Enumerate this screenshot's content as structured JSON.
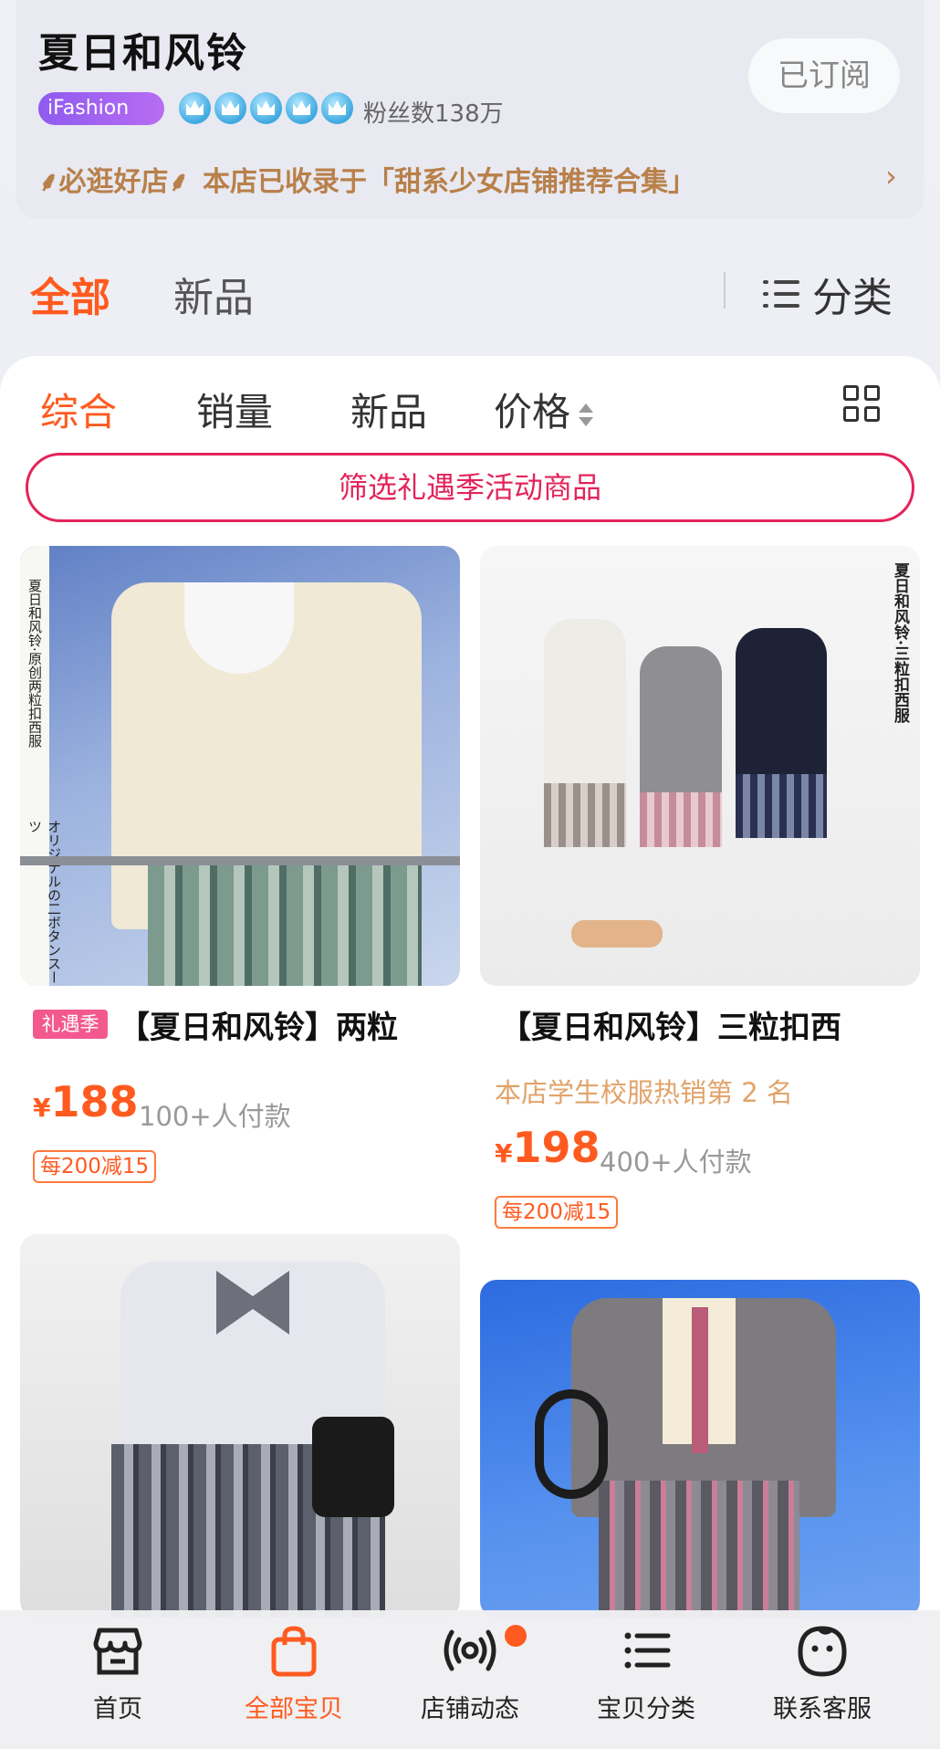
{
  "shop": {
    "name": "夏日和风铃",
    "badge": "iFashion",
    "fans": "粉丝数138万",
    "subscribe_label": "已订阅",
    "promo_badge": "必逛好店",
    "promo_text": "本店已收录于「甜系少女店铺推荐合集」",
    "promo_chevron": "›"
  },
  "top_tabs": {
    "all": "全部",
    "new": "新品",
    "category": "分类"
  },
  "sort_bar": {
    "overall": "综合",
    "sales": "销量",
    "new": "新品",
    "price": "价格"
  },
  "filter_button": "筛选礼遇季活动商品",
  "products": [
    {
      "tag": "礼遇季",
      "title": "【夏日和风铃】两粒",
      "currency": "¥",
      "price": "188",
      "paid": "100+人付款",
      "coupon": "每200减15",
      "image_text_1": "夏日和风铃·原创两粒扣西服",
      "image_text_2": "オリジナルの二ボタンスーツ"
    },
    {
      "title": "【夏日和风铃】三粒扣西",
      "rank": "本店学生校服热销第 2 名",
      "currency": "¥",
      "price": "198",
      "paid": "400+人付款",
      "coupon": "每200减15",
      "image_text_1": "夏日和风铃·三粒扣西服"
    }
  ],
  "bottom_nav": [
    {
      "label": "首页",
      "icon": "storefront-icon"
    },
    {
      "label": "全部宝贝",
      "icon": "shopping-bag-icon"
    },
    {
      "label": "店铺动态",
      "icon": "broadcast-icon"
    },
    {
      "label": "宝贝分类",
      "icon": "list-icon"
    },
    {
      "label": "联系客服",
      "icon": "customer-service-icon"
    }
  ],
  "colors": {
    "accent": "#ff5a1f",
    "filter_pink": "#e3245b",
    "gold": "#b8804a"
  }
}
